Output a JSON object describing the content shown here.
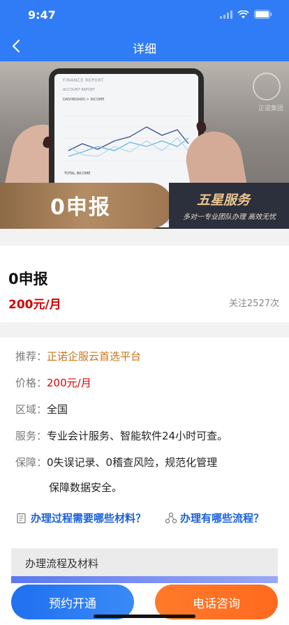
{
  "status_bar": {
    "time": "9:47"
  },
  "nav": {
    "title": "详细"
  },
  "banner": {
    "screen_title": "FINANCE REPORT",
    "screen_tabs": "ACCOUNT     REPORT",
    "screen_dashboard": "DASHBOARD > INCOME",
    "screen_total": "TOTAL INCOME",
    "watermark": "正诺集团",
    "main_text": "0申报",
    "five_star": "五星服务",
    "five_star_sub": "多对一专业团队办理 高效无忧"
  },
  "product": {
    "name": "0申报",
    "price": "200元/月",
    "follow": "关注2527次"
  },
  "details": {
    "recommend_label": "推荐：",
    "recommend_value": "正诺企服云首选平台",
    "price_label": "价格：",
    "price_value": "200元/月",
    "region_label": "区域：",
    "region_value": "全国",
    "service_label": "服务：",
    "service_value": "专业会计服务、智能软件24小时可查。",
    "guarantee_label": "保障：",
    "guarantee_value_1": "0失误记录、0稽查风险，规范化管理",
    "guarantee_value_2": "保障数据安全。"
  },
  "questions": {
    "materials": "办理过程需要哪些材料？",
    "process": "办理有哪些流程？"
  },
  "flow": {
    "title": "办理流程及材料"
  },
  "bottom": {
    "appointment": "预约开通",
    "phone": "电话咨询"
  },
  "colors": {
    "brand_blue": "#2f7cf6",
    "price_red": "#d00000",
    "orange": "#ff6a1f"
  }
}
